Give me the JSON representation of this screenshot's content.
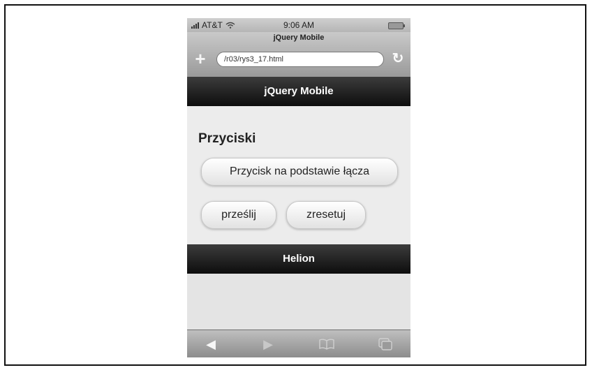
{
  "status": {
    "carrier": "AT&T",
    "time": "9:06 AM"
  },
  "browser": {
    "page_title": "jQuery Mobile",
    "url": "/r03/rys3_17.html"
  },
  "header": {
    "title": "jQuery Mobile"
  },
  "content": {
    "heading": "Przyciski",
    "link_button": "Przycisk na podstawie łącza",
    "submit_button": "prześlij",
    "reset_button": "zresetuj"
  },
  "footer": {
    "title": "Helion"
  },
  "toolbar": {
    "icons": [
      "back-arrow-icon",
      "forward-arrow-icon",
      "bookmarks-icon",
      "pages-icon"
    ]
  }
}
